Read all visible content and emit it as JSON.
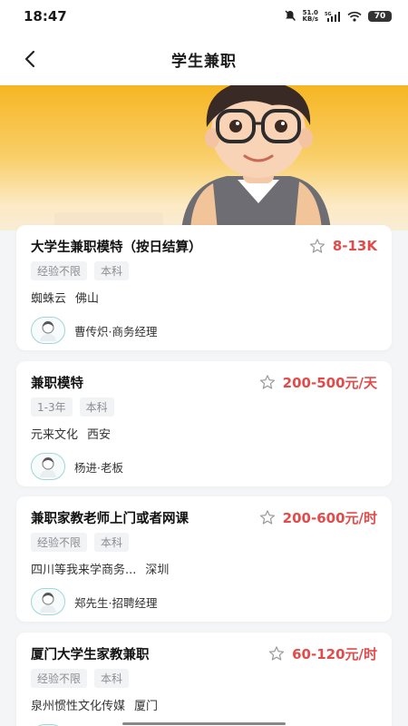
{
  "status_bar": {
    "time": "18:47",
    "speed_value": "51.0",
    "speed_unit": "KB/s",
    "network": "5G",
    "battery": "70"
  },
  "nav": {
    "title": "学生兼职"
  },
  "jobs": [
    {
      "title": "大学生兼职模特（按日结算）",
      "salary": "8-13K",
      "tags": [
        "经验不限",
        "本科"
      ],
      "company": "蜘蛛云",
      "city": "佛山",
      "recruiter": "曹传炽·商务经理"
    },
    {
      "title": "兼职模特",
      "salary": "200-500元/天",
      "tags": [
        "1-3年",
        "本科"
      ],
      "company": "元来文化",
      "city": "西安",
      "recruiter": "杨进·老板"
    },
    {
      "title": "兼职家教老师上门或者网课",
      "salary": "200-600元/时",
      "tags": [
        "经验不限",
        "本科"
      ],
      "company": "四川等我来学商务...",
      "city": "深圳",
      "recruiter": "郑先生·招聘经理"
    },
    {
      "title": "厦门大学生家教兼职",
      "salary": "60-120元/时",
      "tags": [
        "经验不限",
        "本科"
      ],
      "company": "泉州惯性文化传媒",
      "city": "厦门",
      "recruiter": ""
    }
  ],
  "colors": {
    "accent": "#e34b4b",
    "banner": "#f6b623",
    "avatar_border": "#9ed7d6"
  },
  "icons": {
    "back": "chevron-left-icon",
    "favorite": "star-outline-icon",
    "recruiter": "avatar-icon"
  }
}
